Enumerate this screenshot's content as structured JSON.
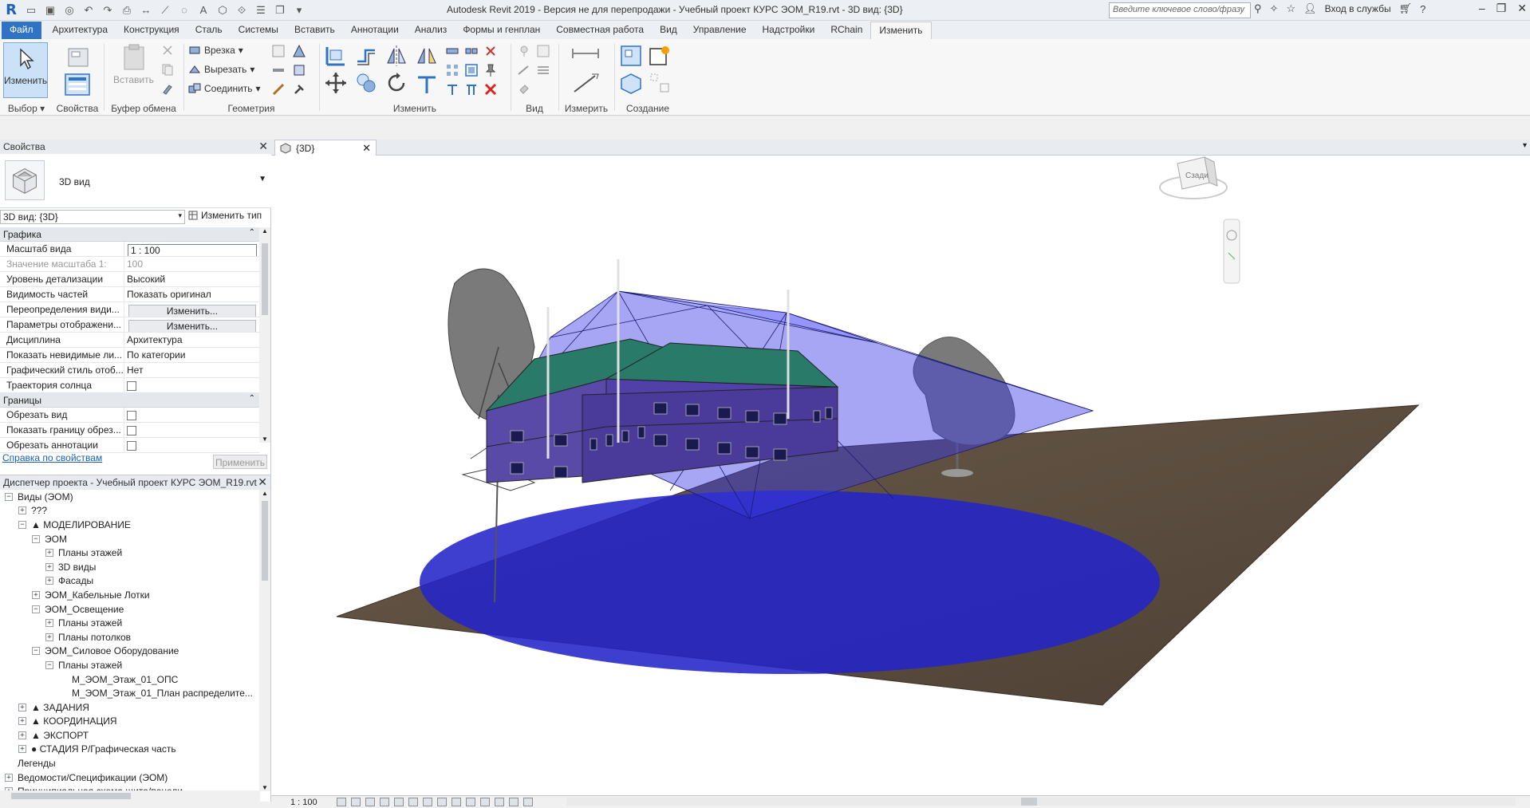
{
  "app": {
    "title": "Autodesk Revit 2019 - Версия не для перепродажи - Учебный проект КУРС ЭОМ_R19.rvt - 3D вид: {3D}",
    "search_placeholder": "Введите ключевое слово/фразу",
    "login": "Вход в службы",
    "logo": "R"
  },
  "tabs": [
    "Файл",
    "Архитектура",
    "Конструкция",
    "Сталь",
    "Системы",
    "Вставить",
    "Аннотации",
    "Анализ",
    "Формы и генплан",
    "Совместная работа",
    "Вид",
    "Управление",
    "Надстройки",
    "RChain",
    "Изменить"
  ],
  "ribbon": {
    "modify_label": "Изменить",
    "select_label": "Выбор",
    "properties_label": "Свойства",
    "clipboard_label": "Буфер обмена",
    "paste_label": "Вставить",
    "geometry_label": "Геометрия",
    "cut_label": "Врезка",
    "cut2_label": "Вырезать",
    "join_label": "Соединить",
    "modify_panel_label": "Изменить",
    "view_label": "Вид",
    "measure_label": "Измерить",
    "create_label": "Создание"
  },
  "properties": {
    "title": "Свойства",
    "type_name": "3D вид",
    "filter": "3D вид: {3D}",
    "edit_type": "Изменить тип",
    "groups": [
      {
        "name": "Графика",
        "rows": [
          {
            "k": "Масштаб вида",
            "v": "1 : 100",
            "kind": "input"
          },
          {
            "k": "Значение масштаба    1:",
            "v": "100",
            "kind": "dis"
          },
          {
            "k": "Уровень детализации",
            "v": "Высокий"
          },
          {
            "k": "Видимость частей",
            "v": "Показать оригинал"
          },
          {
            "k": "Переопределения види...",
            "v": "Изменить...",
            "kind": "btn"
          },
          {
            "k": "Параметры отображени...",
            "v": "Изменить...",
            "kind": "btn"
          },
          {
            "k": "Дисциплина",
            "v": "Архитектура"
          },
          {
            "k": "Показать невидимые ли...",
            "v": "По категории"
          },
          {
            "k": "Графический стиль отоб...",
            "v": "Нет"
          },
          {
            "k": "Траектория солнца",
            "v": "",
            "kind": "chk"
          }
        ]
      },
      {
        "name": "Границы",
        "rows": [
          {
            "k": "Обрезать вид",
            "v": "",
            "kind": "chk"
          },
          {
            "k": "Показать границу обрез...",
            "v": "",
            "kind": "chk"
          },
          {
            "k": "Обрезать аннотации",
            "v": "",
            "kind": "chk"
          }
        ]
      }
    ],
    "help": "Справка по свойствам",
    "apply": "Применить"
  },
  "browser": {
    "title": "Диспетчер проекта - Учебный проект КУРС ЭОМ_R19.rvt",
    "items": [
      {
        "label": "Виды (ЭОМ)",
        "level": 0,
        "tog": "−"
      },
      {
        "label": "???",
        "level": 1,
        "tog": "+"
      },
      {
        "label": "▲ МОДЕЛИРОВАНИЕ",
        "level": 1,
        "tog": "−"
      },
      {
        "label": "ЭОМ",
        "level": 2,
        "tog": "−"
      },
      {
        "label": "Планы этажей",
        "level": 3,
        "tog": "+"
      },
      {
        "label": "3D виды",
        "level": 3,
        "tog": "+"
      },
      {
        "label": "Фасады",
        "level": 3,
        "tog": "+"
      },
      {
        "label": "ЭОМ_Кабельные Лотки",
        "level": 2,
        "tog": "+"
      },
      {
        "label": "ЭОМ_Освещение",
        "level": 2,
        "tog": "−"
      },
      {
        "label": "Планы этажей",
        "level": 3,
        "tog": "+"
      },
      {
        "label": "Планы потолков",
        "level": 3,
        "tog": "+"
      },
      {
        "label": "ЭОМ_Силовое Оборудование",
        "level": 2,
        "tog": "−"
      },
      {
        "label": "Планы этажей",
        "level": 3,
        "tog": "−"
      },
      {
        "label": "М_ЭОМ_Этаж_01_ОПС",
        "level": 4,
        "tog": ""
      },
      {
        "label": "М_ЭОМ_Этаж_01_План распределите...",
        "level": 4,
        "tog": ""
      },
      {
        "label": "▲ ЗАДАНИЯ",
        "level": 1,
        "tog": "+"
      },
      {
        "label": "▲ КООРДИНАЦИЯ",
        "level": 1,
        "tog": "+"
      },
      {
        "label": "▲ ЭКСПОРТ",
        "level": 1,
        "tog": "+"
      },
      {
        "label": "● СТАДИЯ Р/Графическая часть",
        "level": 1,
        "tog": "+"
      },
      {
        "label": "Легенды",
        "level": 0,
        "tog": ""
      },
      {
        "label": "Ведомости/Спецификации (ЭОМ)",
        "level": 0,
        "tog": "+"
      },
      {
        "label": "Принципиальная схема щита/панели",
        "level": 0,
        "tog": "+"
      }
    ]
  },
  "view": {
    "tab": "{3D}",
    "viewcube_label": "Сзади",
    "scale": "1 : 100"
  },
  "colors": {
    "accent": "#2f73c6",
    "ground": "#5a4a3c",
    "light_volume": "#2a2ad8",
    "roof": "#2a7a6a"
  }
}
